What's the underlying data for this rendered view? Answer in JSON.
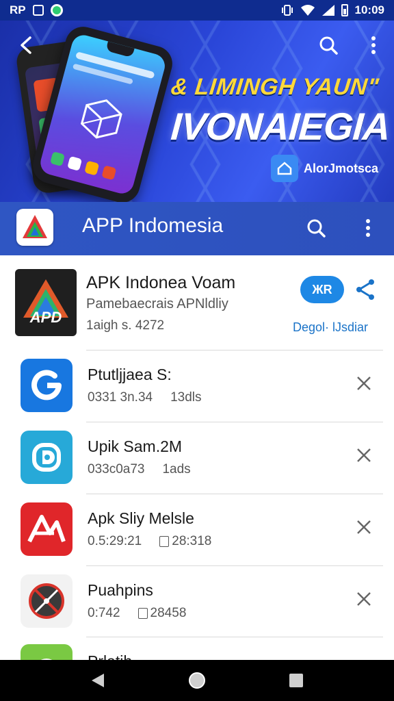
{
  "status_bar": {
    "left_text": "RP",
    "time": "10:09"
  },
  "banner": {
    "line1": "& LIMINGH YAUN\"",
    "line2": "IVONAIEGIA",
    "brand": "AlorJmotsca"
  },
  "app_bar": {
    "title": "APP Indomesia"
  },
  "featured": {
    "title": "APK Indonea Voam",
    "subtitle": "Pamebaecrais APNldliy",
    "meta": "1aigh s. 4272",
    "icon_text": "APD",
    "pill_label": "ЖR",
    "link_text": "Degol· lJsdiar"
  },
  "list": [
    {
      "title": "Ptutljjaea S:",
      "meta_a": "0331 3n.34",
      "meta_b": "13dls",
      "icon": "g-icon",
      "color": "#1877e0"
    },
    {
      "title": "Upik Sam.2M",
      "meta_a": "033c0a73",
      "meta_b": "1ads",
      "icon": "d-icon",
      "color": "#27a9d8"
    },
    {
      "title": "Apk Sliy Melsle",
      "meta_a": "0.5:29:21",
      "meta_b": "28:318",
      "icon": "a-icon",
      "color": "#e0262a"
    },
    {
      "title": "Puahpins",
      "meta_a": "0:742",
      "meta_b": "28458",
      "icon": "compass-icon",
      "color": "#f2f2f2"
    },
    {
      "title": "Prlatih",
      "meta_a": "",
      "meta_b": "",
      "icon": "chat-icon",
      "color": "#7ac943"
    }
  ],
  "colors": {
    "status_bar": "#0f2c8f",
    "app_bar": "#2f56c3",
    "accent": "#1e88e5",
    "link": "#1a73c8"
  }
}
